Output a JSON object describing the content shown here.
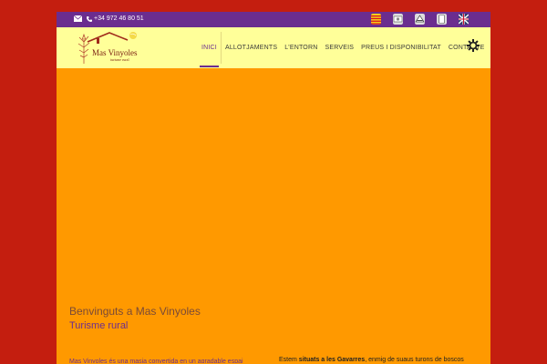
{
  "topbar": {
    "phone": "+34 972 46 80 51",
    "languages": [
      "catalan-flag-icon",
      "spanish-flag-icon",
      "french-flag-icon",
      "german-flag-icon",
      "uk-flag-icon"
    ]
  },
  "header": {
    "logo_title": "Mas Vinyoles",
    "logo_subtitle": "turisme rural"
  },
  "nav": {
    "items": [
      "INICI",
      "ALLOTJAMENTS",
      "L'ENTORN",
      "SERVEIS",
      "PREUS I DISPONIBILITAT",
      "CONTACTE"
    ],
    "active": "INICI"
  },
  "main": {
    "welcome": "Benvinguts a Mas Vinyoles",
    "subtitle": "Turisme rural",
    "para_left": "Mas Vinyoles és una masia convertida en un agradable espai",
    "para_right_pre": "Estem ",
    "para_right_bold": "situats a les Gavarres",
    "para_right_post": ", enmig de suaus turons de boscos"
  },
  "colors": {
    "page_bg": "#c41e0f",
    "content_bg": "#ff9900",
    "topbar_bg": "#6b2d8f",
    "header_bg": "#ffff99",
    "accent": "#6b2d8f"
  }
}
